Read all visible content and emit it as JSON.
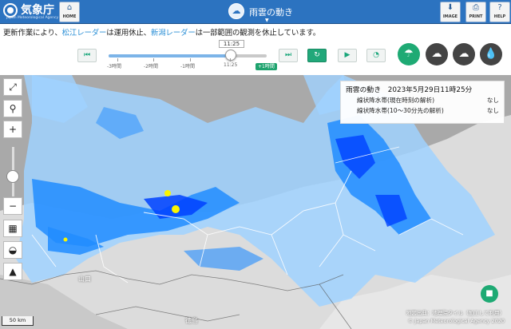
{
  "header": {
    "logo_text": "気象庁",
    "logo_sub": "Japan Meteorological Agency",
    "home_label": "HOME",
    "title": "雨雲の動き",
    "image_label": "IMAGE",
    "print_label": "PRINT",
    "help_label": "HELP"
  },
  "notice": {
    "prefix": "更新作業により、",
    "radar1": "松江レーダー",
    "mid": "は運用休止、",
    "radar2": "新潟レーダー",
    "suffix": "は一部範囲の観測を休止しています。"
  },
  "timeline": {
    "current_time": "11:25",
    "ticks": [
      "-3時間",
      "-2時間",
      "-1時間",
      "11:25"
    ],
    "plus_badge": "+1時間",
    "position_fraction": 0.77
  },
  "map": {
    "legend": {
      "title": "雨雲の動き　2023年5月29日11時25分",
      "rows": [
        {
          "label": "線状降水帯(現在時刻の解析)",
          "value": "なし"
        },
        {
          "label": "線状降水帯(10～30分先の解析)",
          "value": "なし"
        }
      ]
    },
    "place_labels": [
      "山口",
      "徳島"
    ],
    "scale": "50 km",
    "credit": "地図出典：地理院タイル（加工して利用）",
    "copyright": "© Japan Meteorological Agency 2020"
  },
  "colors": {
    "header_bg": "#2c73c0",
    "accent_green": "#1eaa74",
    "rain_light": "#a0d2ff",
    "rain_mid": "#218cff",
    "rain_heavy": "#0041ff",
    "rain_intense": "#faf500"
  }
}
